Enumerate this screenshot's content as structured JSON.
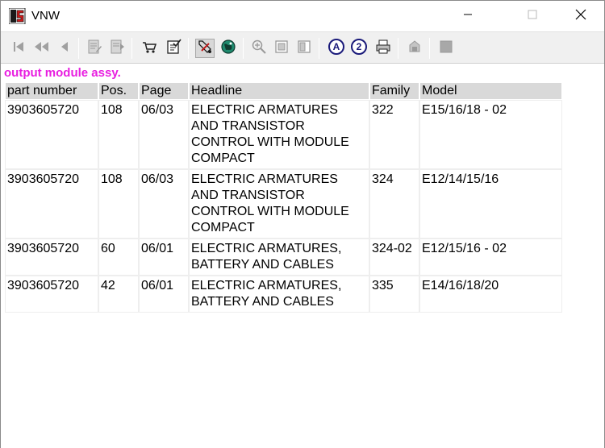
{
  "window": {
    "title": "VNW",
    "icon": "vnw-app-icon",
    "controls": [
      "minimize-icon",
      "maximize-icon",
      "close-icon"
    ]
  },
  "toolbar": {
    "buttons": [
      {
        "name": "first-page-icon"
      },
      {
        "name": "previous-many-icon"
      },
      {
        "name": "previous-icon"
      },
      {
        "name": "edit-document-icon"
      },
      {
        "name": "next-document-icon"
      },
      {
        "name": "cart-icon"
      },
      {
        "name": "checklist-icon"
      },
      {
        "name": "pen-tool-icon"
      },
      {
        "name": "globe-icon"
      },
      {
        "name": "zoom-in-icon"
      },
      {
        "name": "fit-page-icon"
      },
      {
        "name": "fit-width-icon"
      },
      {
        "name": "search-a-icon"
      },
      {
        "name": "search-2-icon"
      },
      {
        "name": "print-icon"
      },
      {
        "name": "stamp-icon"
      },
      {
        "name": "stop-icon"
      }
    ]
  },
  "content": {
    "heading": "output module assy.",
    "columns": [
      "part number",
      "Pos.",
      "Page",
      "Headline",
      "Family",
      "Model"
    ],
    "rows": [
      {
        "part": "3903605720",
        "pos": "108",
        "page": "06/03",
        "headline_lines": [
          "ELECTRIC ARMATURES",
          "AND TRANSISTOR",
          "CONTROL WITH MODULE",
          "COMPACT"
        ],
        "family": "322",
        "model": "E15/16/18 - 02"
      },
      {
        "part": "3903605720",
        "pos": "108",
        "page": "06/03",
        "headline_lines": [
          "ELECTRIC ARMATURES",
          "AND TRANSISTOR",
          "CONTROL WITH MODULE",
          "COMPACT"
        ],
        "family": "324",
        "model": "E12/14/15/16"
      },
      {
        "part": "3903605720",
        "pos": "60",
        "page": "06/01",
        "headline_lines": [
          "ELECTRIC ARMATURES,",
          "BATTERY AND CABLES"
        ],
        "family": "324-02",
        "model": "E12/15/16 - 02"
      },
      {
        "part": "3903605720",
        "pos": "42",
        "page": "06/01",
        "headline_lines": [
          "ELECTRIC ARMATURES,",
          "BATTERY AND CABLES"
        ],
        "family": "335",
        "model": "E14/16/18/20"
      }
    ]
  },
  "colors": {
    "heading": "#e81ee0",
    "headline_link": "#2323c8",
    "header_bg": "#d9d9d9",
    "toolbar_bg": "#f0f0f0"
  }
}
